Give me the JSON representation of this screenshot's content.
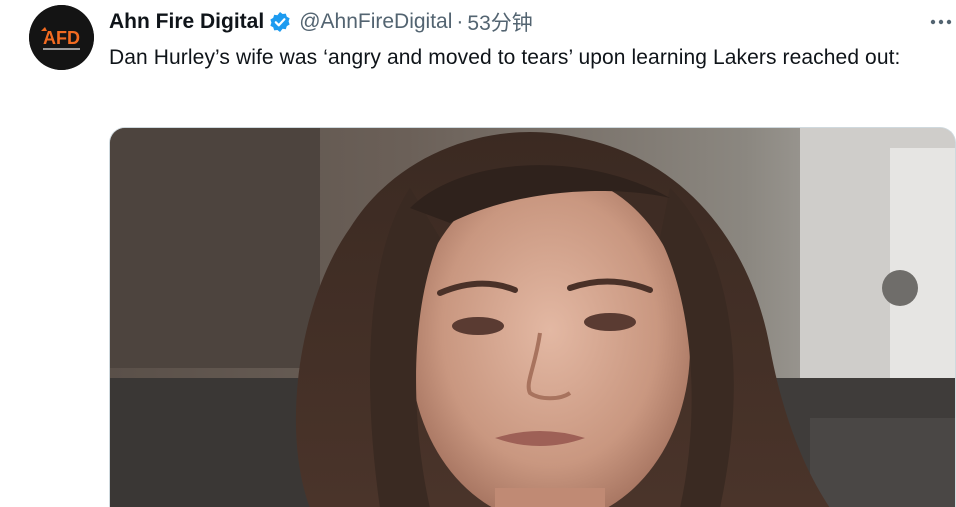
{
  "tweet": {
    "author_name": "Ahn Fire Digital",
    "handle": "@AhnFireDigital",
    "separator": "·",
    "time": "53分钟",
    "text": "Dan Hurley’s wife was ‘angry and moved to tears’ upon learning Lakers reached out:",
    "avatar_logo_text": "AFD",
    "verified_color": "#1d9bf0",
    "icons": {
      "verified": "verified-badge-icon",
      "more": "more-options-icon"
    },
    "media": {
      "kind": "video-thumbnail"
    }
  }
}
